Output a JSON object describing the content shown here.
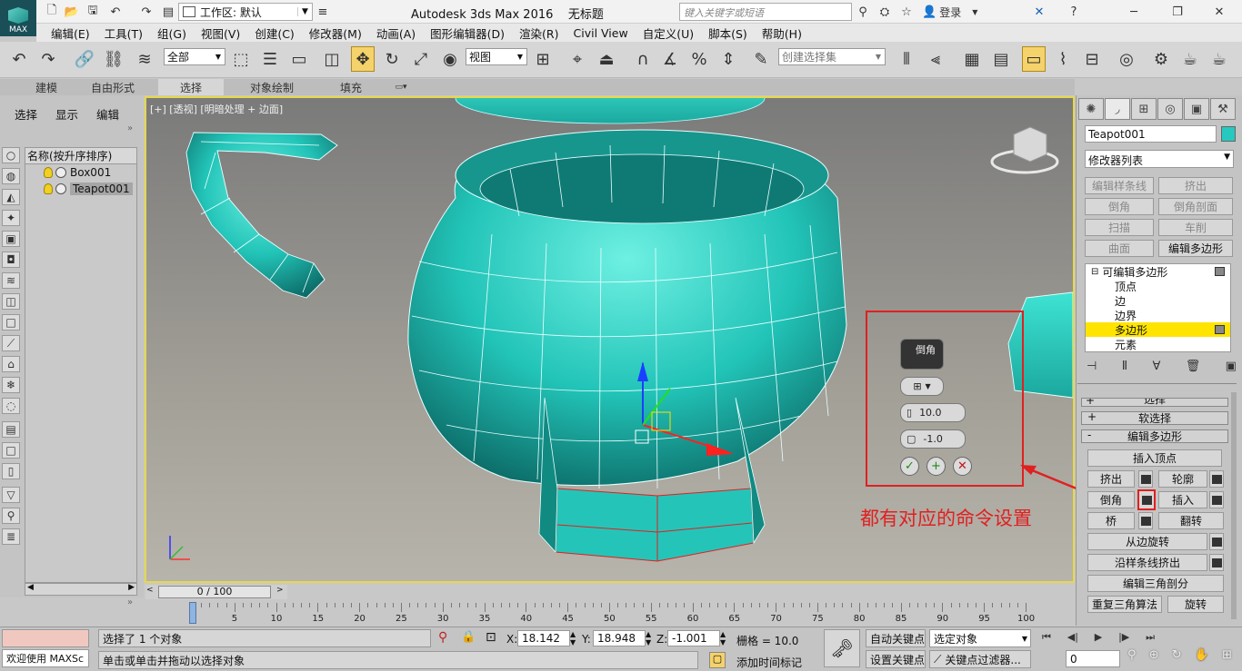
{
  "title_bar": {
    "logo": "MAX",
    "workspace_label": "工作区: 默认",
    "app_title": "Autodesk 3ds Max 2016",
    "doc_title": "无标题",
    "search_placeholder": "键入关键字或短语",
    "login": "登录"
  },
  "menu": [
    "编辑(E)",
    "工具(T)",
    "组(G)",
    "视图(V)",
    "创建(C)",
    "修改器(M)",
    "动画(A)",
    "图形编辑器(D)",
    "渲染(R)",
    "Civil View",
    "自定义(U)",
    "脚本(S)",
    "帮助(H)"
  ],
  "toolbar": {
    "filter_value": "全部",
    "refcoord_value": "视图",
    "named_sel_placeholder": "创建选择集"
  },
  "ribbon_tabs": [
    "建模",
    "自由形式",
    "选择",
    "对象绘制",
    "填充"
  ],
  "explorer": {
    "tabs": [
      "选择",
      "显示",
      "编辑"
    ],
    "header": "名称(按升序排序)",
    "items": [
      "Box001",
      "Teapot001"
    ],
    "scroll_value": "0 / 100"
  },
  "viewport": {
    "label": "[+] [透视] [明暗处理 + 边面]",
    "caddy": {
      "title": "倒角",
      "height_value": "10.0",
      "outline_value": "-1.0"
    },
    "annotation": "都有对应的命令设置"
  },
  "command_panel": {
    "object_name": "Teapot001",
    "object_color": "#26c9c0",
    "modifier_list": "修改器列表",
    "modifier_buttons": [
      {
        "label": "编辑样条线",
        "enabled": false
      },
      {
        "label": "挤出",
        "enabled": false
      },
      {
        "label": "倒角",
        "enabled": false
      },
      {
        "label": "倒角剖面",
        "enabled": false
      },
      {
        "label": "扫描",
        "enabled": false
      },
      {
        "label": "车削",
        "enabled": false
      },
      {
        "label": "曲面",
        "enabled": false
      },
      {
        "label": "编辑多边形",
        "enabled": true
      }
    ],
    "stack": {
      "root": "可编辑多边形",
      "subs": [
        "顶点",
        "边",
        "边界",
        "多边形",
        "元素"
      ],
      "selected": "多边形"
    },
    "rollouts": [
      "选择",
      "软选择",
      "编辑多边形"
    ],
    "edit_poly": {
      "insert_vertex": "插入顶点",
      "rows": [
        [
          "挤出",
          "轮廓"
        ],
        [
          "倒角",
          "插入"
        ],
        [
          "桥",
          "翻转"
        ]
      ],
      "hinge": "从边旋转",
      "extrude_spline": "沿样条线挤出",
      "edit_tri": "编辑三角剖分",
      "retri": "重复三角算法",
      "turn": "旋转"
    }
  },
  "timeline": {
    "ticks": [
      0,
      5,
      10,
      15,
      20,
      25,
      30,
      35,
      40,
      45,
      50,
      55,
      60,
      65,
      70,
      75,
      80,
      85,
      90,
      95,
      100
    ]
  },
  "status": {
    "welcome": "欢迎使用 MAXSc",
    "selected": "选择了 1 个对象",
    "prompt": "单击或单击并拖动以选择对象",
    "x_value": "18.142",
    "y_value": "18.948",
    "z_value": "-1.001",
    "grid": "栅格 = 10.0",
    "add_time_tag": "添加时间标记",
    "auto_key": "自动关键点",
    "set_key": "设置关键点",
    "key_target": "选定对象",
    "key_filters": "关键点过滤器...",
    "frame_value": "0"
  }
}
